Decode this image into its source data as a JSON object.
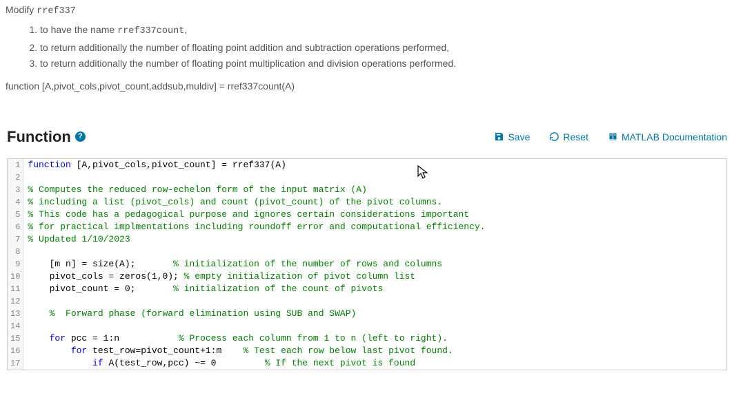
{
  "header": {
    "modify_prefix": "Modify ",
    "modify_target": "rref337",
    "items": [
      {
        "prefix": "to have the name ",
        "code": "rref337count",
        "suffix": ","
      },
      {
        "prefix": "to return additionally the number of floating point addition and subtraction operations performed,",
        "code": "",
        "suffix": ""
      },
      {
        "prefix": "to return additionally the number of floating point multiplication and division operations performed.",
        "code": "",
        "suffix": ""
      }
    ],
    "signature": "function [A,pivot_cols,pivot_count,addsub,muldiv] = rref337count(A)"
  },
  "section": {
    "title": "Function",
    "help": "?"
  },
  "toolbar": {
    "save": "Save",
    "reset": "Reset",
    "docs": "MATLAB Documentation"
  },
  "code": {
    "lines": [
      {
        "n": 1,
        "tokens": [
          {
            "t": "kw",
            "v": "function"
          },
          {
            "t": "pl",
            "v": " [A,pivot_cols,pivot_count] = rref337(A)"
          }
        ]
      },
      {
        "n": 2,
        "tokens": []
      },
      {
        "n": 3,
        "tokens": [
          {
            "t": "cm",
            "v": "% Computes the reduced row-echelon form of the input matrix (A)"
          }
        ]
      },
      {
        "n": 4,
        "tokens": [
          {
            "t": "cm",
            "v": "% including a list (pivot_cols) and count (pivot_count) of the pivot columns."
          }
        ]
      },
      {
        "n": 5,
        "tokens": [
          {
            "t": "cm",
            "v": "% This code has a pedagogical purpose and ignores certain considerations important"
          }
        ]
      },
      {
        "n": 6,
        "tokens": [
          {
            "t": "cm",
            "v": "% for practical implmentations including roundoff error and computational efficiency."
          }
        ]
      },
      {
        "n": 7,
        "tokens": [
          {
            "t": "cm",
            "v": "% Updated 1/10/2023"
          }
        ]
      },
      {
        "n": 8,
        "tokens": []
      },
      {
        "n": 9,
        "tokens": [
          {
            "t": "pl",
            "v": "    [m n] = size(A);       "
          },
          {
            "t": "cm",
            "v": "% initialization of the number of rows and columns"
          }
        ]
      },
      {
        "n": 10,
        "tokens": [
          {
            "t": "pl",
            "v": "    pivot_cols = zeros(1,0); "
          },
          {
            "t": "cm",
            "v": "% empty initialization of pivot column list"
          }
        ]
      },
      {
        "n": 11,
        "tokens": [
          {
            "t": "pl",
            "v": "    pivot_count = 0;       "
          },
          {
            "t": "cm",
            "v": "% initialization of the count of pivots"
          }
        ]
      },
      {
        "n": 12,
        "tokens": []
      },
      {
        "n": 13,
        "tokens": [
          {
            "t": "pl",
            "v": "    "
          },
          {
            "t": "cm",
            "v": "%  Forward phase (forward elimination using SUB and SWAP)"
          }
        ]
      },
      {
        "n": 14,
        "tokens": []
      },
      {
        "n": 15,
        "tokens": [
          {
            "t": "pl",
            "v": "    "
          },
          {
            "t": "kw",
            "v": "for"
          },
          {
            "t": "pl",
            "v": " pcc = 1:n           "
          },
          {
            "t": "cm",
            "v": "% Process each column from 1 to n (left to right)."
          }
        ]
      },
      {
        "n": 16,
        "tokens": [
          {
            "t": "pl",
            "v": "        "
          },
          {
            "t": "kw",
            "v": "for"
          },
          {
            "t": "pl",
            "v": " test_row=pivot_count+1:m    "
          },
          {
            "t": "cm",
            "v": "% Test each row below last pivot found."
          }
        ]
      },
      {
        "n": 17,
        "tokens": [
          {
            "t": "pl",
            "v": "            "
          },
          {
            "t": "kw",
            "v": "if"
          },
          {
            "t": "pl",
            "v": " A(test_row,pcc) ~= 0         "
          },
          {
            "t": "cm",
            "v": "% If the next pivot is found"
          }
        ]
      }
    ]
  }
}
